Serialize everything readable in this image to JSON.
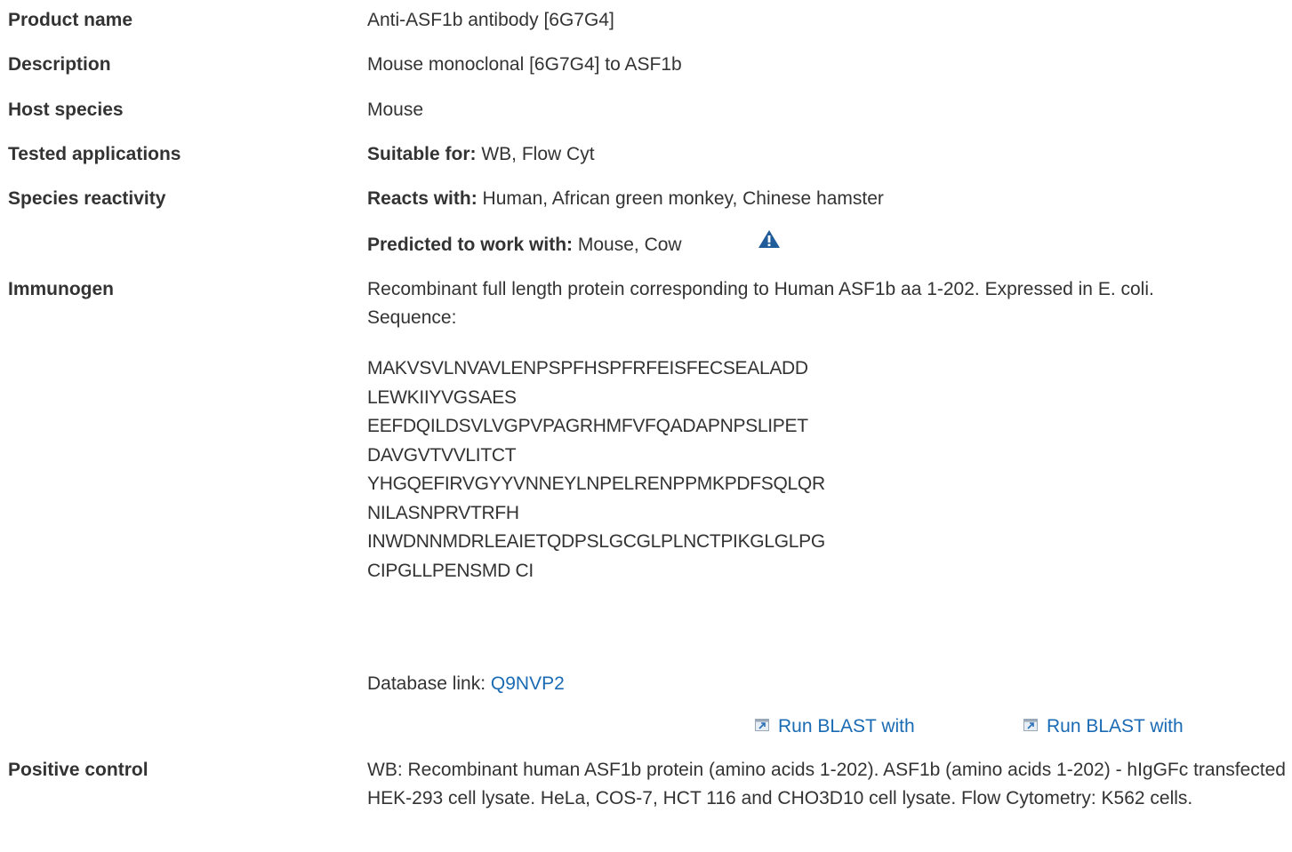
{
  "rows": {
    "product_name": {
      "label": "Product name",
      "value": "Anti-ASF1b antibody [6G7G4]"
    },
    "description": {
      "label": "Description",
      "value": "Mouse monoclonal [6G7G4] to ASF1b"
    },
    "host_species": {
      "label": "Host species",
      "value": "Mouse"
    },
    "tested_applications": {
      "label": "Tested applications",
      "prefix": "Suitable for:",
      "value": "WB, Flow Cyt"
    },
    "species_reactivity": {
      "label": "Species reactivity",
      "reacts_prefix": "Reacts with:",
      "reacts_value": "Human, African green monkey, Chinese hamster",
      "predicted_prefix": "Predicted to work with:",
      "predicted_value": "Mouse, Cow",
      "icon": "warning-triangle-icon"
    },
    "immunogen": {
      "label": "Immunogen",
      "text": "Recombinant full length protein corresponding to Human ASF1b aa 1-202. Expressed in E. coli.",
      "sequence_label": "Sequence:",
      "sequence_lines": [
        "MAKVSVLNVAVLENPSPFHSPFRFEISFECSEALADD",
        "LEWKIIYVGSAES",
        "EEFDQILDSVLVGPVPAGRHMFVFQADAPNPSLIPET",
        "DAVGVTVVLITCT",
        "YHGQEFIRVGYYVNNEYLNPELRENPPMKPDFSQLQR",
        "NILASNPRVTRFH",
        "INWDNNMDRLEAIETQDPSLGCGLPLNCTPIKGLGLPG",
        "CIPGLLPENSMD CI"
      ],
      "database_prefix": "Database link:",
      "database_link": "Q9NVP2",
      "blast_links": [
        "Run BLAST with",
        "Run BLAST with"
      ]
    },
    "positive_control": {
      "label": "Positive control",
      "value": "WB: Recombinant human ASF1b protein (amino acids 1-202). ASF1b (amino acids 1-202) - hIgGFc transfected HEK-293 cell lysate. HeLa, COS-7, HCT 116 and CHO3D10 cell lysate. Flow Cytometry: K562 cells."
    }
  },
  "colors": {
    "text": "#333333",
    "link": "#1a6bb3",
    "warning_icon": "#1f5c99"
  }
}
